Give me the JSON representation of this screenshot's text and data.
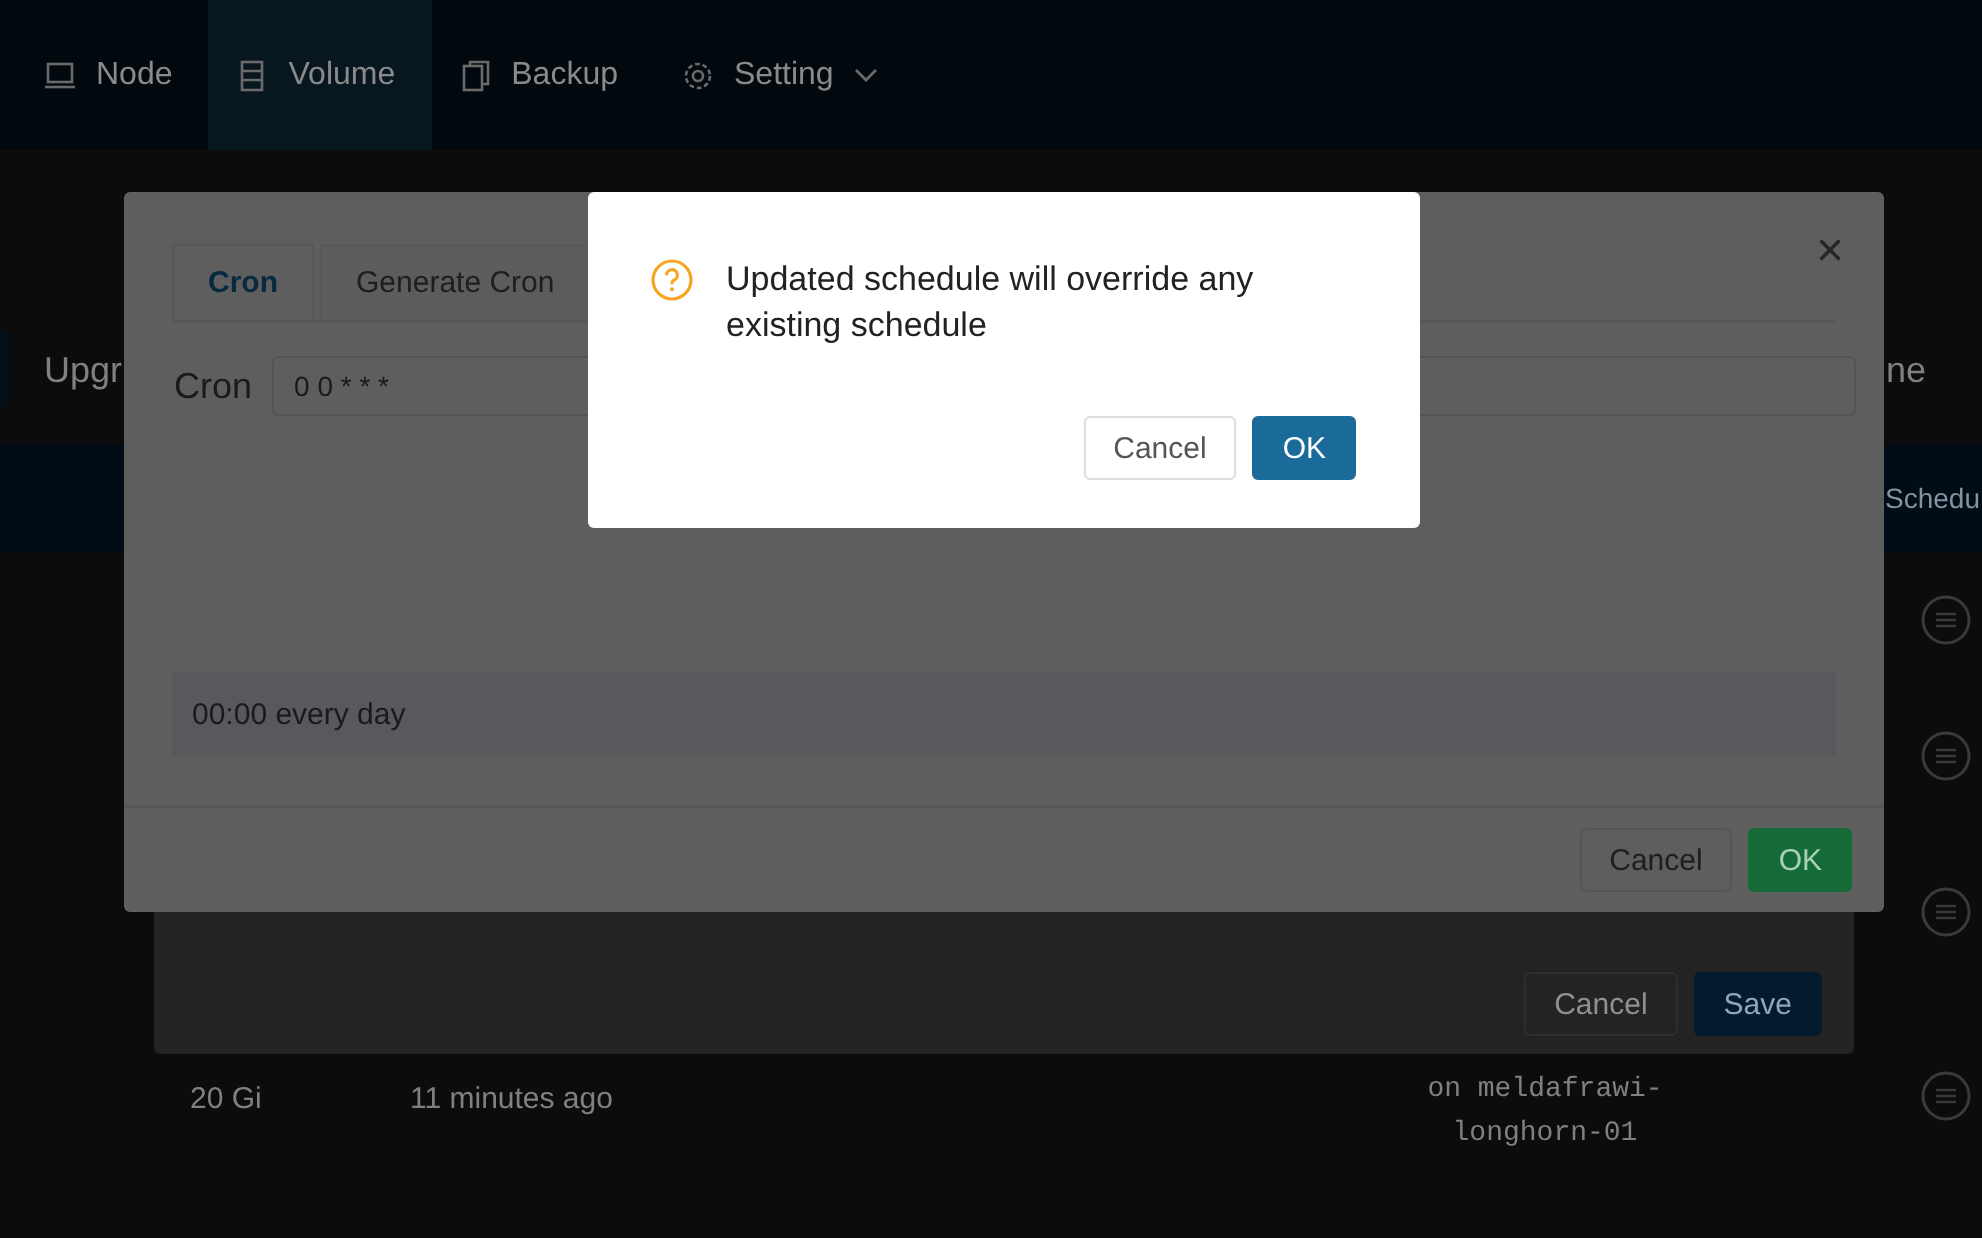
{
  "nav": {
    "items": [
      {
        "label": "Node",
        "selected": false,
        "dropdown": false
      },
      {
        "label": "Volume",
        "selected": true,
        "dropdown": false
      },
      {
        "label": "Backup",
        "selected": false,
        "dropdown": false
      },
      {
        "label": "Setting",
        "selected": false,
        "dropdown": true
      }
    ]
  },
  "toolbar": {
    "action_label": "Upgr",
    "right_text": "ne"
  },
  "table": {
    "header_text": "Schedu",
    "rows": [
      {},
      {},
      {},
      {
        "cells": [
          "20 Gi",
          "11 minutes ago",
          "on meldafrawi-longhorn-01"
        ]
      }
    ]
  },
  "edit_modal": {
    "buttons": [
      {
        "label": "Cancel",
        "kind": "secondary"
      },
      {
        "label": "Save",
        "kind": "primary"
      }
    ]
  },
  "cron_modal": {
    "tabs": [
      {
        "label": "Cron",
        "selected": true
      },
      {
        "label": "Generate Cron",
        "selected": false
      }
    ],
    "close": "×",
    "field_label": "Cron",
    "field_value": "0 0 * * *",
    "description": "00:00 every day",
    "buttons": [
      {
        "label": "Cancel",
        "kind": "secondary"
      },
      {
        "label": "OK",
        "kind": "success"
      }
    ]
  },
  "confirm": {
    "message": "Updated schedule will override any existing schedule",
    "buttons": [
      {
        "label": "Cancel",
        "kind": "secondary"
      },
      {
        "label": "OK",
        "kind": "primary"
      }
    ]
  }
}
